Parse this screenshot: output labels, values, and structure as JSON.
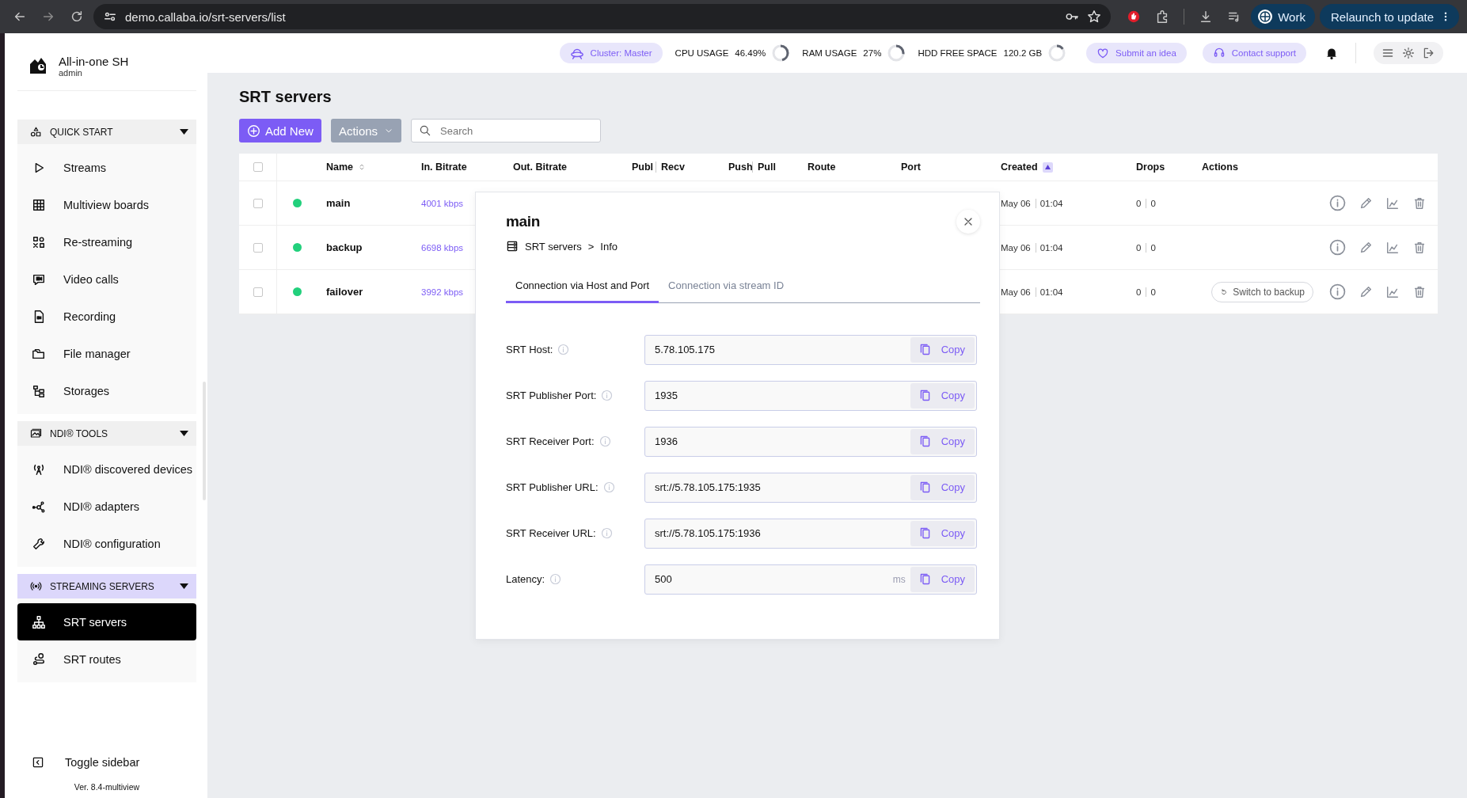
{
  "browser": {
    "url": "demo.callaba.io/srt-servers/list",
    "profile": "Work",
    "update_button": "Relaunch to update"
  },
  "app": {
    "name": "All-in-one SH",
    "user": "admin"
  },
  "sidebar": {
    "sections": [
      {
        "title": "QUICK START",
        "expanded": true,
        "active": false,
        "items": [
          {
            "label": "Streams",
            "selected": false
          },
          {
            "label": "Multiview boards",
            "selected": false
          },
          {
            "label": "Re-streaming",
            "selected": false
          },
          {
            "label": "Video calls",
            "selected": false
          },
          {
            "label": "Recording",
            "selected": false
          },
          {
            "label": "File manager",
            "selected": false
          },
          {
            "label": "Storages",
            "selected": false
          }
        ]
      },
      {
        "title": "NDI® TOOLS",
        "expanded": true,
        "active": false,
        "items": [
          {
            "label": "NDI® discovered devices",
            "selected": false
          },
          {
            "label": "NDI® adapters",
            "selected": false
          },
          {
            "label": "NDI® configuration",
            "selected": false
          }
        ]
      },
      {
        "title": "STREAMING SERVERS",
        "expanded": true,
        "active": true,
        "items": [
          {
            "label": "SRT servers",
            "selected": true
          },
          {
            "label": "SRT routes",
            "selected": false
          }
        ]
      }
    ],
    "toggle": "Toggle sidebar",
    "version": "Ver. 8.4-multiview"
  },
  "topbar": {
    "cluster": "Cluster: Master",
    "meters": [
      {
        "label": "CPU USAGE",
        "reading": "46.49%",
        "level": 0.46
      },
      {
        "label": "RAM USAGE",
        "reading": "27%",
        "level": 0.27
      },
      {
        "label": "HDD FREE SPACE",
        "reading": "120.2 GB",
        "level": 0.15
      }
    ],
    "submit": "Submit an idea",
    "support": "Contact support"
  },
  "page": {
    "title": "SRT servers",
    "add_button": "Add New",
    "actions_button": "Actions",
    "search": {
      "placeholder": "Search"
    }
  },
  "table": {
    "header_checked": false,
    "columns": [
      {
        "label": "Name",
        "sorted": false
      },
      {
        "label": "In. Bitrate"
      },
      {
        "label": "Out. Bitrate"
      },
      {
        "label": "Publ"
      },
      {
        "label": "Recv",
        "kind": "paired"
      },
      {
        "label": "Push"
      },
      {
        "label": "Pull",
        "kind": "paired"
      },
      {
        "label": "Route"
      },
      {
        "label": "Port"
      },
      {
        "label": "Created",
        "sorted": true
      },
      {
        "label": "Drops"
      },
      {
        "label": "Actions"
      }
    ],
    "rows": [
      {
        "checked": false,
        "color": "#22d07c",
        "name": "main",
        "in_bitrate": "4001 kbps",
        "date": "May 06",
        "time": "01:04",
        "drops": [
          "0",
          "0"
        ]
      },
      {
        "checked": false,
        "color": "#22d07c",
        "name": "backup",
        "in_bitrate": "6698 kbps",
        "date": "May 06",
        "time": "01:04",
        "drops": [
          "0",
          "0"
        ]
      },
      {
        "checked": false,
        "color": "#22d07c",
        "name": "failover",
        "in_bitrate": "3992 kbps",
        "date": "May 06",
        "time": "01:04",
        "drops": [
          "0",
          "0"
        ],
        "action": "Switch to backup"
      }
    ]
  },
  "modal": {
    "title": "main",
    "breadcrumb": [
      "SRT servers",
      ">",
      "Info"
    ],
    "tabs": [
      {
        "label": "Connection via Host and Port",
        "selected": true
      },
      {
        "label": "Connection via stream ID",
        "selected": false
      }
    ],
    "fields": [
      {
        "label": "SRT Host:",
        "value": "5.78.105.175",
        "copy": "Copy"
      },
      {
        "label": "SRT Publisher Port:",
        "value": "1935",
        "copy": "Copy"
      },
      {
        "label": "SRT Receiver Port:",
        "value": "1936",
        "copy": "Copy"
      },
      {
        "label": "SRT Publisher URL:",
        "value": "srt://5.78.105.175:1935",
        "copy": "Copy"
      },
      {
        "label": "SRT Receiver URL:",
        "value": "srt://5.78.105.175:1936",
        "copy": "Copy"
      },
      {
        "label": "Latency:",
        "value": "500",
        "unit": "ms",
        "copy": "Copy"
      }
    ]
  }
}
